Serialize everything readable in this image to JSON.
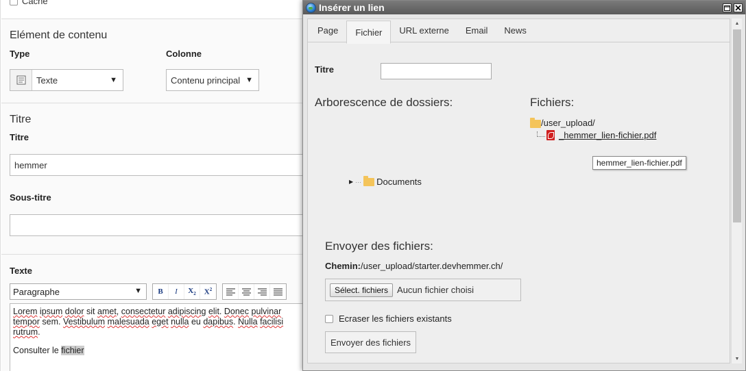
{
  "form": {
    "cache_label": "Cache",
    "content_section_title": "Elément de contenu",
    "type_label": "Type",
    "type_value": "Texte",
    "column_label": "Colonne",
    "column_value": "Contenu principal",
    "title_section_title": "Titre",
    "title_label": "Titre",
    "title_value": "hemmer",
    "subtitle_label": "Sous-titre",
    "subtitle_value": "",
    "text_label": "Texte",
    "paragraph_select": "Paragraphe",
    "editor": {
      "line1_a": "Lorem",
      "line1_b": " ",
      "line1_c": "ipsum",
      "line1_d": " ",
      "line1_e": "dolor",
      "line1_f": " sit ",
      "line1_g": "amet",
      "line1_h": ", ",
      "line1_i": "consectetur",
      "line1_j": " ",
      "line1_k": "adipiscing",
      "line1_l": " ",
      "line1_m": "elit",
      "line1_n": ". ",
      "line1_o": "Donec",
      "line1_p": " ",
      "line1_q": "pulvinar",
      "line2_a": "tempor",
      "line2_b": " sem. ",
      "line2_c": "Vestibulum",
      "line2_d": " ",
      "line2_e": "malesuada",
      "line2_f": " ",
      "line2_g": "eget",
      "line2_h": " ",
      "line2_i": "nulla",
      "line2_j": " eu ",
      "line2_k": "dapibus",
      "line2_l": ". ",
      "line2_m": "Nulla",
      "line2_n": " ",
      "line2_o": "facilisi",
      "line3": "rutrum",
      "line3_end": ".",
      "p2_prefix": "Consulter le ",
      "p2_link": "fichier"
    }
  },
  "modal": {
    "title": "Insérer un lien",
    "tabs": [
      {
        "label": "Page"
      },
      {
        "label": "Fichier"
      },
      {
        "label": "URL externe"
      },
      {
        "label": "Email"
      },
      {
        "label": "News"
      }
    ],
    "titre_label": "Titre",
    "titre_value": "",
    "tree_heading": "Arborescence de dossiers:",
    "files_heading": "Fichiers:",
    "folder_path": "/user_upload/",
    "file_name": "_hemmer_lien-fichier.pdf",
    "tooltip": "hemmer_lien-fichier.pdf",
    "documents_folder": "Documents",
    "upload_heading": "Envoyer des fichiers:",
    "path_label": "Chemin:",
    "path_value": "/user_upload/starter.devhemmer.ch/",
    "select_files_button": "Sélect. fichiers",
    "no_file_chosen": "Aucun fichier choisi",
    "overwrite_label": "Ecraser les fichiers existants",
    "send_button": "Envoyer des fichiers"
  }
}
